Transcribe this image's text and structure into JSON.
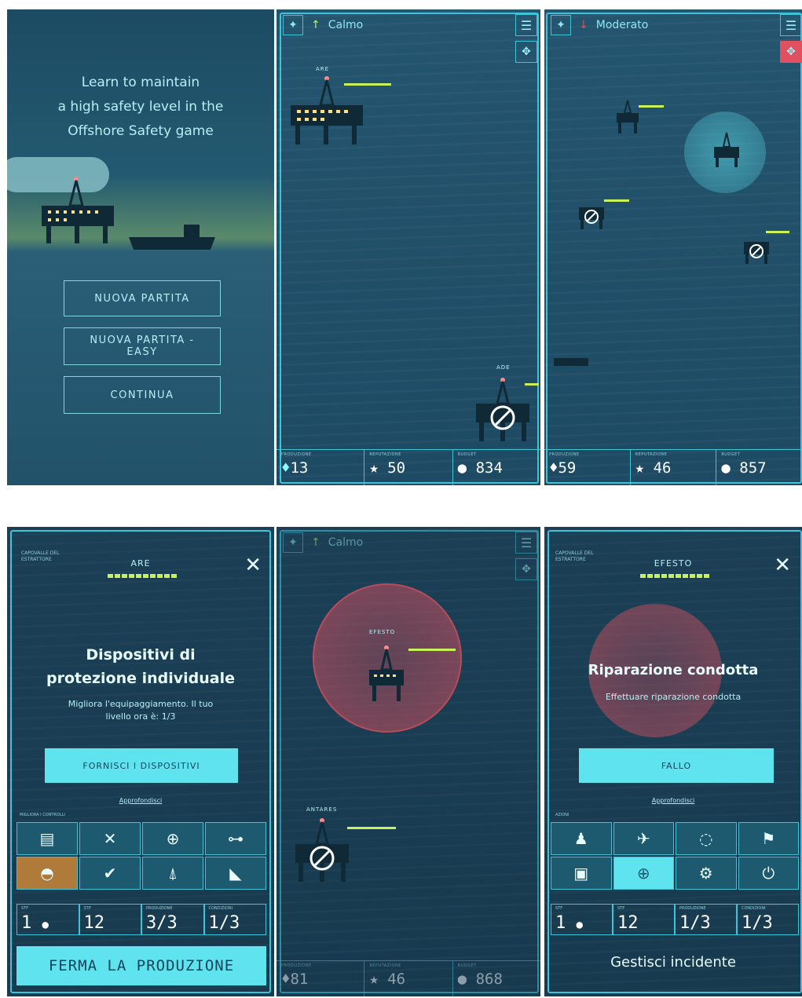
{
  "intro": {
    "tagline": "Learn to maintain\na high safety level in the\nOffshore Safety game",
    "buttons": [
      "NUOVA PARTITA",
      "NUOVA PARTITA -\nEASY",
      "CONTINUA"
    ]
  },
  "game1": {
    "weather": "Calmo",
    "rig_top_label": "ARE",
    "rig_bottom_label": "ADE",
    "stats": [
      {
        "label": "PRODUZIONE",
        "value": "13",
        "icon": "flame-drop-icon"
      },
      {
        "label": "REPUTAZIONE",
        "value": "50",
        "icon": "star-icon"
      },
      {
        "label": "BUDGET",
        "value": "834",
        "icon": "coin-icon"
      }
    ]
  },
  "game2": {
    "weather": "Moderato",
    "stats": [
      {
        "label": "PRODUZIONE",
        "value": "59",
        "icon": "flame-drop-icon"
      },
      {
        "label": "REPUTAZIONE",
        "value": "46",
        "icon": "star-icon"
      },
      {
        "label": "BUDGET",
        "value": "857",
        "icon": "coin-icon"
      }
    ]
  },
  "upgrade": {
    "header_small": "CAPOVALLE DEL\nESTRATTORE",
    "rig_name": "ARE",
    "title": "Dispositivi di\nprotezione individuale",
    "description": "Migliora l'equipaggiamento. Il tuo\nlivello ora è: 1/3",
    "action_label": "FORNISCI I DISPOSITIVI",
    "link": "Approfondisci",
    "section_label": "MIGLIORA I CONTROLLI",
    "stats": [
      {
        "label": "STF",
        "value": "1"
      },
      {
        "label": "STP",
        "value": "12"
      },
      {
        "label": "PRODUZIONE",
        "value": "3/3"
      },
      {
        "label": "CONDIZIONI",
        "value": "1/3"
      }
    ],
    "stop_label": "FERMA LA PRODUZIONE"
  },
  "game3": {
    "weather": "Calmo",
    "rig_top_label": "EFESTO",
    "rig_bottom_label": "ANTARES",
    "stats": [
      {
        "label": "PRODUZIONE",
        "value": "81"
      },
      {
        "label": "REPUTAZIONE",
        "value": "46"
      },
      {
        "label": "BUDGET",
        "value": "868"
      }
    ]
  },
  "incident": {
    "header_small": "CAPOVALLE DEL\nESTRATTORE",
    "rig_name": "EFESTO",
    "title": "Riparazione condotta",
    "description": "Effettuare riparazione condotta",
    "action_label": "FALLO",
    "link": "Approfondisci",
    "section_label": "AZIONI",
    "stats": [
      {
        "label": "STF",
        "value": "1"
      },
      {
        "label": "STP",
        "value": "12"
      },
      {
        "label": "PRODUZIONE",
        "value": "1/3"
      },
      {
        "label": "CONDIZIONI",
        "value": "1/3"
      }
    ],
    "footer_label": "Gestisci incidente"
  },
  "colors": {
    "accent": "#5fe3ee",
    "sea": "#24556f",
    "production_bar": "#c9f25a",
    "alert": "#e0505f"
  }
}
